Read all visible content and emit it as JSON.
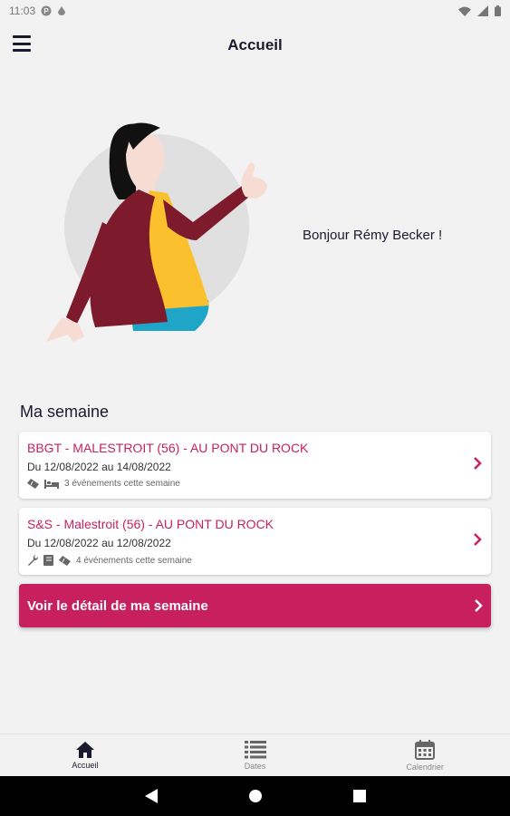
{
  "status_bar": {
    "time": "11:03"
  },
  "app_bar": {
    "title": "Accueil"
  },
  "greeting": "Bonjour Rémy Becker !",
  "week": {
    "title": "Ma semaine",
    "cards": [
      {
        "title": "BBGT - MALESTROIT (56) - AU PONT DU ROCK",
        "dates": "Du 12/08/2022 au 14/08/2022",
        "events": "3 événements cette semaine",
        "icons": [
          "ticket-icon",
          "bed-icon"
        ]
      },
      {
        "title": "S&S - Malestroit (56) - AU PONT DU ROCK",
        "dates": "Du 12/08/2022 au 12/08/2022",
        "events": "4 événements cette semaine",
        "icons": [
          "wrench-icon",
          "book-icon",
          "ticket-icon"
        ]
      }
    ],
    "cta_label": "Voir le détail de ma semaine"
  },
  "bottom_nav": [
    {
      "label": "Accueil",
      "icon": "home-icon",
      "active": true
    },
    {
      "label": "Dates",
      "icon": "list-icon",
      "active": false
    },
    {
      "label": "Calendrier",
      "icon": "calendar-icon",
      "active": false
    }
  ],
  "colors": {
    "accent": "#c8205e",
    "primary_text": "#1a1a2e",
    "background": "#f2f2f2"
  }
}
